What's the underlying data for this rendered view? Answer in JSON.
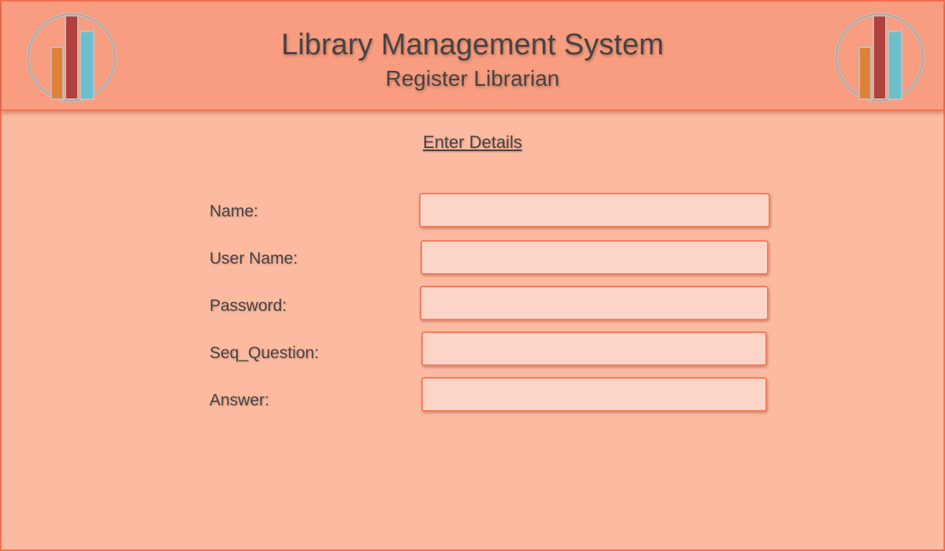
{
  "header": {
    "title": "Library Management System",
    "subtitle": "Register Librarian",
    "logo_icon": "books-logo-icon"
  },
  "form": {
    "heading": "Enter Details",
    "fields": [
      {
        "label": "Name:",
        "value": "",
        "placeholder": ""
      },
      {
        "label": "User Name:",
        "value": "",
        "placeholder": ""
      },
      {
        "label": "Password:",
        "value": "",
        "placeholder": ""
      },
      {
        "label": "Seq_Question:",
        "value": "",
        "placeholder": ""
      },
      {
        "label": "Answer:",
        "value": "",
        "placeholder": ""
      }
    ]
  },
  "colors": {
    "background": "#fcbba0",
    "header": "#f89d80",
    "border": "#f3704f",
    "input_fill": "#fdd5c8",
    "book_orange": "#e0813a",
    "book_red": "#b0413e",
    "book_teal": "#6cbfcd"
  }
}
